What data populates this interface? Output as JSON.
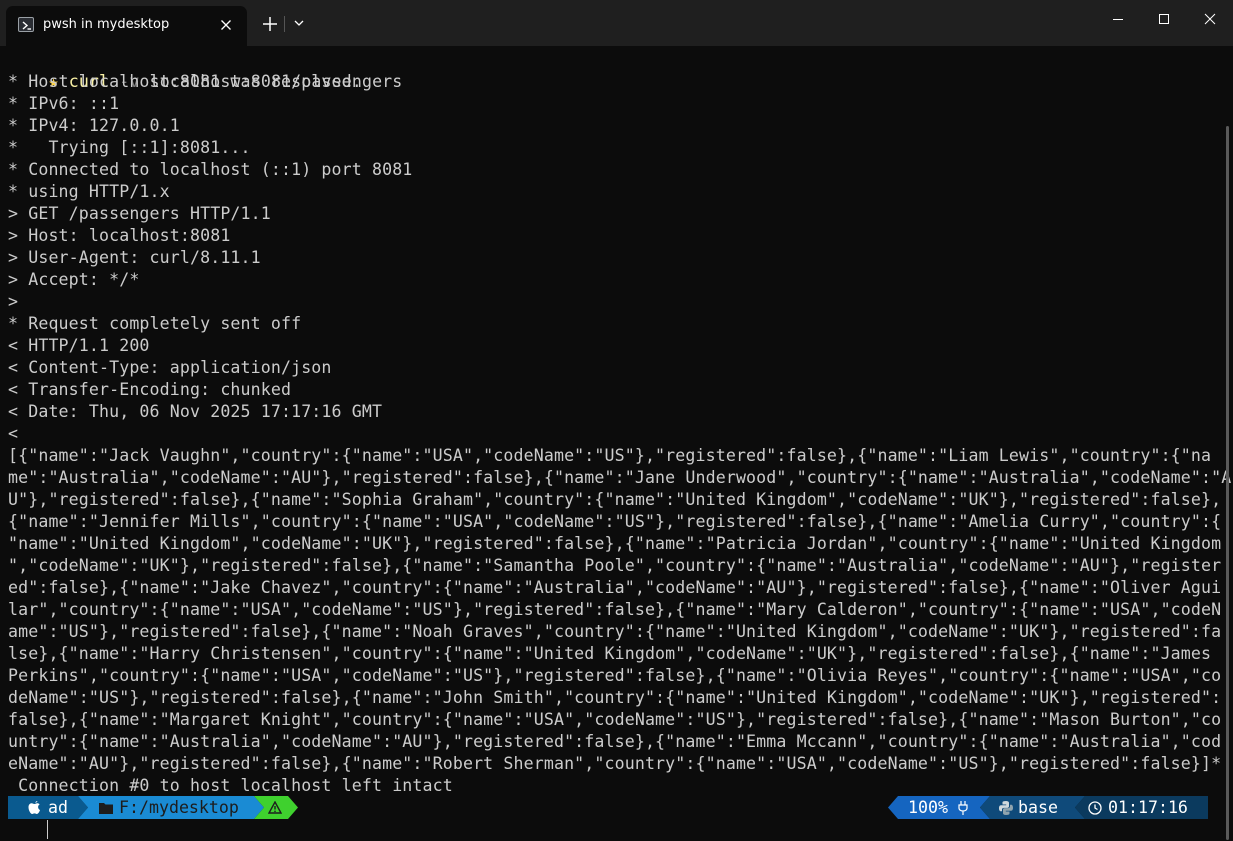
{
  "window": {
    "tab_title": "pwsh in mydesktop",
    "icons": {
      "tab": "powershell-icon",
      "close_tab": "close-icon",
      "new_tab": "plus-icon",
      "dropdown": "chevron-down-icon",
      "minimize": "minimize-icon",
      "maximize": "maximize-icon",
      "close": "close-icon"
    }
  },
  "terminal": {
    "prompt_symbol": "★",
    "command": {
      "program": "curl",
      "flag": "-v",
      "argument": "localhost:8081/passengers"
    },
    "output_lines": [
      "* Host localhost:8081 was resolved.",
      "* IPv6: ::1",
      "* IPv4: 127.0.0.1",
      "*   Trying [::1]:8081...",
      "* Connected to localhost (::1) port 8081",
      "* using HTTP/1.x",
      "> GET /passengers HTTP/1.1",
      "> Host: localhost:8081",
      "> User-Agent: curl/8.11.1",
      "> Accept: */*",
      ">",
      "* Request completely sent off",
      "< HTTP/1.1 200",
      "< Content-Type: application/json",
      "< Transfer-Encoding: chunked",
      "< Date: Thu, 06 Nov 2025 17:17:16 GMT",
      "<",
      "[{\"name\":\"Jack Vaughn\",\"country\":{\"name\":\"USA\",\"codeName\":\"US\"},\"registered\":false},{\"name\":\"Liam Lewis\",\"country\":{\"na",
      "me\":\"Australia\",\"codeName\":\"AU\"},\"registered\":false},{\"name\":\"Jane Underwood\",\"country\":{\"name\":\"Australia\",\"codeName\":\"A",
      "U\"},\"registered\":false},{\"name\":\"Sophia Graham\",\"country\":{\"name\":\"United Kingdom\",\"codeName\":\"UK\"},\"registered\":false},",
      "{\"name\":\"Jennifer Mills\",\"country\":{\"name\":\"USA\",\"codeName\":\"US\"},\"registered\":false},{\"name\":\"Amelia Curry\",\"country\":{",
      "\"name\":\"United Kingdom\",\"codeName\":\"UK\"},\"registered\":false},{\"name\":\"Patricia Jordan\",\"country\":{\"name\":\"United Kingdom",
      "\",\"codeName\":\"UK\"},\"registered\":false},{\"name\":\"Samantha Poole\",\"country\":{\"name\":\"Australia\",\"codeName\":\"AU\"},\"register",
      "ed\":false},{\"name\":\"Jake Chavez\",\"country\":{\"name\":\"Australia\",\"codeName\":\"AU\"},\"registered\":false},{\"name\":\"Oliver Agui",
      "lar\",\"country\":{\"name\":\"USA\",\"codeName\":\"US\"},\"registered\":false},{\"name\":\"Mary Calderon\",\"country\":{\"name\":\"USA\",\"codeN",
      "ame\":\"US\"},\"registered\":false},{\"name\":\"Noah Graves\",\"country\":{\"name\":\"United Kingdom\",\"codeName\":\"UK\"},\"registered\":fa",
      "lse},{\"name\":\"Harry Christensen\",\"country\":{\"name\":\"United Kingdom\",\"codeName\":\"UK\"},\"registered\":false},{\"name\":\"James ",
      "Perkins\",\"country\":{\"name\":\"USA\",\"codeName\":\"US\"},\"registered\":false},{\"name\":\"Olivia Reyes\",\"country\":{\"name\":\"USA\",\"co",
      "deName\":\"US\"},\"registered\":false},{\"name\":\"John Smith\",\"country\":{\"name\":\"United Kingdom\",\"codeName\":\"UK\"},\"registered\":",
      "false},{\"name\":\"Margaret Knight\",\"country\":{\"name\":\"USA\",\"codeName\":\"US\"},\"registered\":false},{\"name\":\"Mason Burton\",\"co",
      "untry\":{\"name\":\"Australia\",\"codeName\":\"AU\"},\"registered\":false},{\"name\":\"Emma Mccann\",\"country\":{\"name\":\"Australia\",\"cod",
      "eName\":\"AU\"},\"registered\":false},{\"name\":\"Robert Sherman\",\"country\":{\"name\":\"USA\",\"codeName\":\"US\"},\"registered\":false}]*",
      " Connection #0 to host localhost left intact"
    ]
  },
  "status_bar": {
    "os_icon": "apple-icon",
    "user": "ad",
    "folder_icon": "folder-icon",
    "path": "F:/mydesktop",
    "warning_icon": "warning-icon",
    "battery": "100%",
    "battery_icon": "plug-icon",
    "python_icon": "python-icon",
    "env": "base",
    "clock_icon": "clock-icon",
    "time": "01:17:16",
    "colors": {
      "user_bg": "#0a5a8f",
      "path_bg": "#1a8bd4",
      "warn_bg": "#3fd12e",
      "battery_bg": "#1565c0",
      "env_bg": "#0f4a7a",
      "time_bg": "#0b3a5e"
    }
  },
  "next_prompt_symbol": "★"
}
